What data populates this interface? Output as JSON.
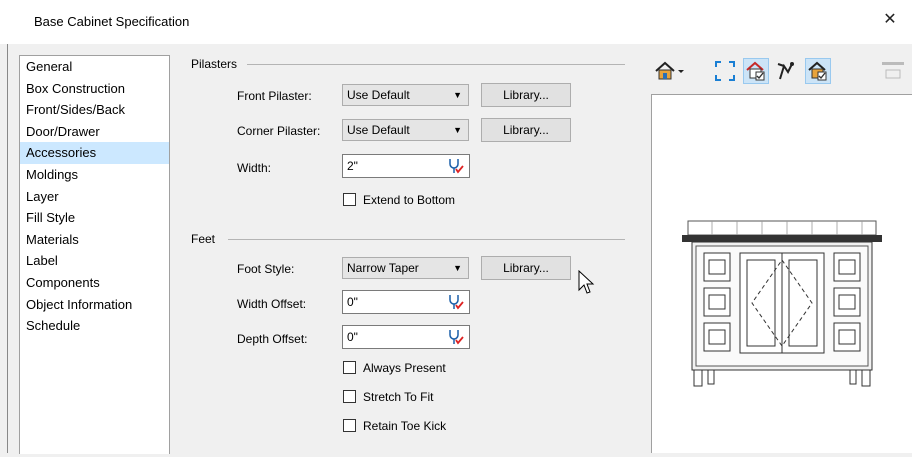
{
  "window": {
    "title": "Base Cabinet Specification",
    "close_glyph": "✕"
  },
  "sidebar": {
    "items": [
      {
        "label": "General"
      },
      {
        "label": "Box Construction"
      },
      {
        "label": "Front/Sides/Back"
      },
      {
        "label": "Door/Drawer"
      },
      {
        "label": "Accessories",
        "selected": true
      },
      {
        "label": "Moldings"
      },
      {
        "label": "Layer"
      },
      {
        "label": "Fill Style"
      },
      {
        "label": "Materials"
      },
      {
        "label": "Label"
      },
      {
        "label": "Components"
      },
      {
        "label": "Object Information"
      },
      {
        "label": "Schedule"
      }
    ]
  },
  "pilasters": {
    "group_label": "Pilasters",
    "front_label": "Front Pilaster:",
    "front_value": "Use Default",
    "corner_label": "Corner Pilaster:",
    "corner_value": "Use Default",
    "library_label": "Library...",
    "width_label": "Width:",
    "width_value": "2\"",
    "extend_label": "Extend to Bottom"
  },
  "feet": {
    "group_label": "Feet",
    "style_label": "Foot Style:",
    "style_value": "Narrow Taper",
    "library_label": "Library...",
    "width_offset_label": "Width Offset:",
    "width_offset_value": "0\"",
    "depth_offset_label": "Depth Offset:",
    "depth_offset_value": "0\"",
    "always_present_label": "Always Present",
    "stretch_label": "Stretch To Fit",
    "retain_label": "Retain Toe Kick"
  },
  "toolbar": {
    "icons": [
      "camera-view-icon",
      "fill-window-icon",
      "show-all-icon",
      "render-style-icon",
      "material-view-icon",
      "disabled-tool-icon"
    ]
  }
}
